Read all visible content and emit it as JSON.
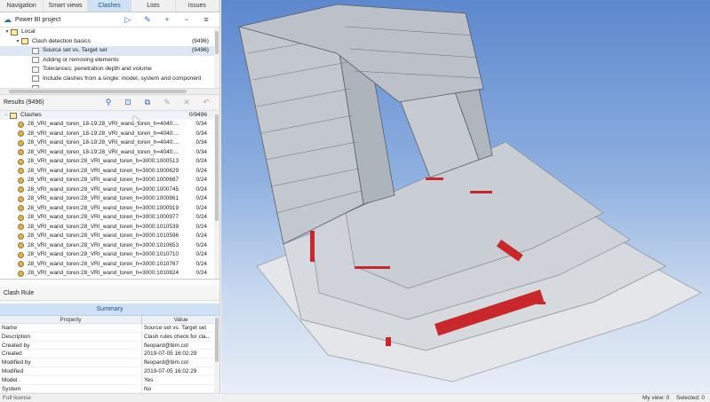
{
  "tabs": [
    {
      "label": "Navigation",
      "active": false
    },
    {
      "label": "Smart views",
      "active": false
    },
    {
      "label": "Clashes",
      "active": true
    },
    {
      "label": "Lists",
      "active": false
    },
    {
      "label": "Issues",
      "active": false
    }
  ],
  "project": {
    "title": "Power BI project"
  },
  "tree": {
    "items": [
      {
        "label": "Local",
        "count": "",
        "indent": 0,
        "toggle": "▾",
        "icon": "grp"
      },
      {
        "label": "Clash detection basics",
        "count": "(9496)",
        "indent": 1,
        "toggle": "▾",
        "icon": "grp"
      },
      {
        "label": "Source set vs. Target set",
        "count": "(9496)",
        "indent": 2,
        "toggle": "",
        "icon": "ind",
        "selected": true
      },
      {
        "label": "Adding or removing elements",
        "count": "",
        "indent": 2,
        "toggle": "",
        "icon": "ind"
      },
      {
        "label": "Tolerances: penetration depth and volume",
        "count": "",
        "indent": 2,
        "toggle": "",
        "icon": "ind"
      },
      {
        "label": "Include clashes from a single: model, system and component",
        "count": "",
        "indent": 2,
        "toggle": "",
        "icon": "ind"
      },
      {
        "label": "...",
        "count": "",
        "indent": 2,
        "toggle": "",
        "icon": "ind"
      }
    ]
  },
  "results": {
    "title": "Results (9496)",
    "root_label": "Clashes",
    "root_count": "0/9496",
    "rows": [
      {
        "name": "28_VRI_wand_toren_18-19:28_VRI_wand_toren_h=4040:...",
        "count": "0/34"
      },
      {
        "name": "28_VRI_wand_toren_18-19:28_VRI_wand_toren_h=4040:...",
        "count": "0/34"
      },
      {
        "name": "28_VRI_wand_toren_18-19:28_VRI_wand_toren_h=4040:...",
        "count": "0/34"
      },
      {
        "name": "28_VRI_wand_toren_18-19:28_VRI_wand_toren_h=4040:...",
        "count": "0/34"
      },
      {
        "name": "28_VRI_wand_toren:28_VRI_wand_toren_h=3000:1000513",
        "count": "0/24"
      },
      {
        "name": "28_VRI_wand_toren:28_VRI_wand_toren_h=3000:1000629",
        "count": "0/24"
      },
      {
        "name": "28_VRI_wand_toren:28_VRI_wand_toren_h=3000:1000687",
        "count": "0/24"
      },
      {
        "name": "28_VRI_wand_toren:28_VRI_wand_toren_h=3000:1000745",
        "count": "0/24"
      },
      {
        "name": "28_VRI_wand_toren:28_VRI_wand_toren_h=3000:1000861",
        "count": "0/24"
      },
      {
        "name": "28_VRI_wand_toren:28_VRI_wand_toren_h=3000:1000919",
        "count": "0/24"
      },
      {
        "name": "28_VRI_wand_toren:28_VRI_wand_toren_h=3000:1000977",
        "count": "0/24"
      },
      {
        "name": "28_VRI_wand_toren:28_VRI_wand_toren_h=3000:1010539",
        "count": "0/24"
      },
      {
        "name": "28_VRI_wand_toren:28_VRI_wand_toren_h=3000:1010596",
        "count": "0/24"
      },
      {
        "name": "28_VRI_wand_toren:28_VRI_wand_toren_h=3000:1010653",
        "count": "0/24"
      },
      {
        "name": "28_VRI_wand_toren:28_VRI_wand_toren_h=3000:1010710",
        "count": "0/24"
      },
      {
        "name": "28_VRI_wand_toren:28_VRI_wand_toren_h=3000:1010767",
        "count": "0/24"
      },
      {
        "name": "28_VRI_wand_toren:28_VRI_wand_toren_h=3000:1010824",
        "count": "0/24"
      }
    ]
  },
  "clash_rule": {
    "title": "Clash Rule",
    "summary": "Summary",
    "col_property": "Property",
    "col_value": "Value",
    "rows": [
      {
        "property": "Name",
        "value": "Source set vs. Target set"
      },
      {
        "property": "Description",
        "value": "Clash rules check for cla..."
      },
      {
        "property": "Created by",
        "value": "fleopard@bim.col"
      },
      {
        "property": "Created",
        "value": "2019-07-05 16:02:29"
      },
      {
        "property": "Modified by",
        "value": "fleopard@bim.col"
      },
      {
        "property": "Modified",
        "value": "2019-07-05 16:02:29"
      },
      {
        "property": "Model",
        "value": "Yes"
      },
      {
        "property": "System",
        "value": "No"
      }
    ]
  },
  "license": "Full license",
  "status": {
    "my_view": "My view: 0",
    "selected": "Selected: 0"
  },
  "colors": {
    "accent": "#2f6cb5",
    "active_tab": "#cfe2f5",
    "clash_red": "#c8282a",
    "sky_top": "#5d88ce"
  }
}
